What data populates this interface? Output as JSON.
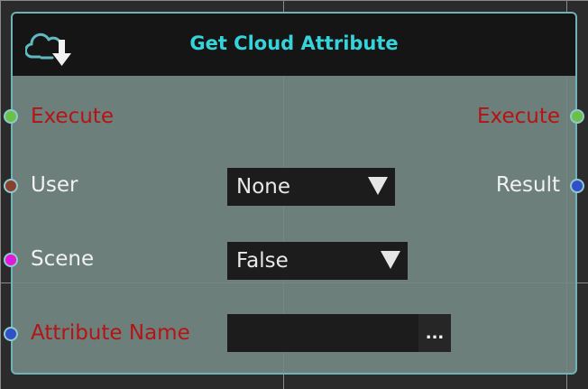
{
  "node": {
    "title": "Get Cloud Attribute",
    "icon": "cloud-download-icon"
  },
  "inputs": {
    "execute": "Execute",
    "user": "User",
    "scene": "Scene",
    "attribute_name": "Attribute Name"
  },
  "outputs": {
    "execute": "Execute",
    "result": "Result"
  },
  "controls": {
    "user_value": "None",
    "scene_value": "False",
    "attribute_value": "",
    "browse_label": "..."
  },
  "colors": {
    "exec_pin": "#6cc04a",
    "user_pin": "#8a4030",
    "scene_pin": "#e01ad8",
    "attribute_pin": "#3050c8",
    "result_pin": "#3050c8",
    "title": "#36d3da",
    "exec_text": "#b41414"
  }
}
